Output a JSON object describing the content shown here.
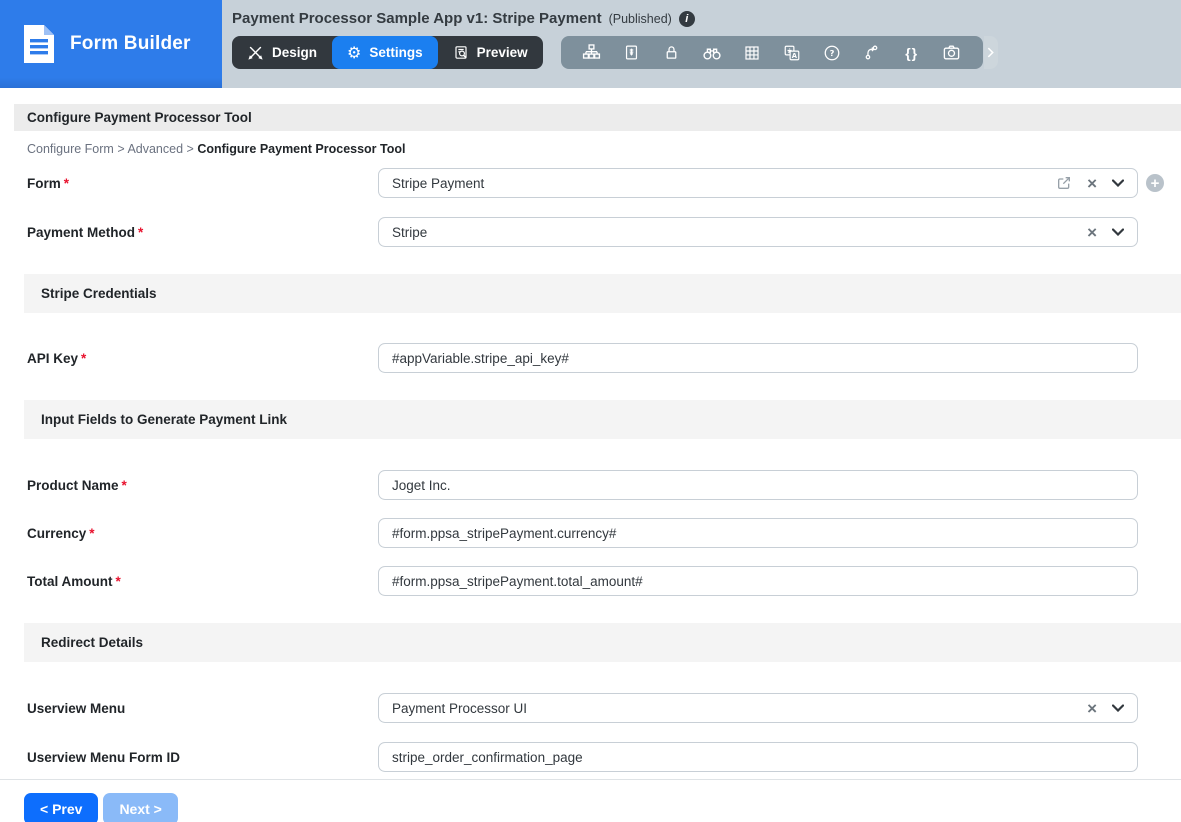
{
  "header": {
    "logo_title": "Form Builder",
    "title": "Payment Processor Sample App v1: Stripe Payment",
    "published": "(Published)",
    "info_glyph": "i",
    "tabs": {
      "design": "Design",
      "settings": "Settings",
      "preview": "Preview"
    },
    "settings_gear_glyph": "⚙",
    "braces_glyph": "{}",
    "toolbar_icons": [
      "sitemap-icon",
      "form-properties-icon",
      "lock-icon",
      "binoculars-icon",
      "grid-icon",
      "translate-icon",
      "help-icon",
      "git-branch-icon",
      "braces-icon",
      "camera-icon",
      "more-chevron-icon"
    ]
  },
  "colors": {
    "logo_blue": "#2e7cea",
    "active_tab_blue": "#1b7ff0",
    "header_bg": "#c7d1d9",
    "icon_bar_bg": "#7e909c",
    "tab_dark_bg": "#32383e",
    "prev_button_blue": "#0d6efd",
    "next_button_light_blue": "#8abaf8",
    "required_red": "#e8112d"
  },
  "page": {
    "title": "Configure Payment Processor Tool",
    "breadcrumb": {
      "part1": "Configure Form",
      "sep1": ">",
      "part2": "Advanced",
      "sep2": ">",
      "current": "Configure Payment Processor Tool"
    },
    "required_marker": "*",
    "clear_glyph": "×",
    "plus_glyph": "+"
  },
  "sections": {
    "credentials": "Stripe Credentials",
    "input_fields": "Input Fields to Generate Payment Link",
    "redirect": "Redirect Details"
  },
  "fields": {
    "form": {
      "label": "Form",
      "value": "Stripe Payment"
    },
    "payment_method": {
      "label": "Payment Method",
      "value": "Stripe"
    },
    "api_key": {
      "label": "API Key",
      "value": "#appVariable.stripe_api_key#"
    },
    "product_name": {
      "label": "Product Name",
      "value": "Joget Inc."
    },
    "currency": {
      "label": "Currency",
      "value": "#form.ppsa_stripePayment.currency#"
    },
    "total_amount": {
      "label": "Total Amount",
      "value": "#form.ppsa_stripePayment.total_amount#"
    },
    "userview_menu": {
      "label": "Userview Menu",
      "value": "Payment Processor UI"
    },
    "userview_menu_form_id": {
      "label": "Userview Menu Form ID",
      "value": "stripe_order_confirmation_page"
    }
  },
  "footer": {
    "prev": "< Prev",
    "next": "Next >"
  }
}
